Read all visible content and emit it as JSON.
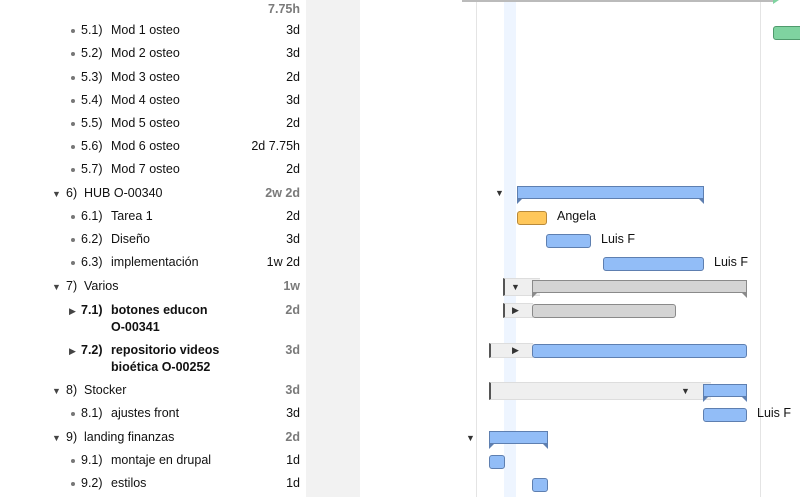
{
  "outline": {
    "top_partial_duration": "7.75h",
    "rows": [
      {
        "num": "5.1)",
        "name": "Mod 1 osteo",
        "duration": "3d",
        "kind": "leaf"
      },
      {
        "num": "5.2)",
        "name": "Mod 2 osteo",
        "duration": "3d",
        "kind": "leaf"
      },
      {
        "num": "5.3)",
        "name": "Mod 3 osteo",
        "duration": "2d",
        "kind": "leaf"
      },
      {
        "num": "5.4)",
        "name": "Mod 4 osteo",
        "duration": "3d",
        "kind": "leaf"
      },
      {
        "num": "5.5)",
        "name": "Mod 5 osteo",
        "duration": "2d",
        "kind": "leaf"
      },
      {
        "num": "5.6)",
        "name": "Mod 6 osteo",
        "duration": "2d 7.75h",
        "kind": "leaf"
      },
      {
        "num": "5.7)",
        "name": "Mod 7 osteo",
        "duration": "2d",
        "kind": "leaf"
      },
      {
        "num": "6)",
        "name": "HUB O-00340",
        "duration": "2w 2d",
        "kind": "group"
      },
      {
        "num": "6.1)",
        "name": "Tarea 1",
        "duration": "2d",
        "kind": "leaf"
      },
      {
        "num": "6.2)",
        "name": "Diseño",
        "duration": "3d",
        "kind": "leaf"
      },
      {
        "num": "6.3)",
        "name": "implementación",
        "duration": "1w 2d",
        "kind": "leaf"
      },
      {
        "num": "7)",
        "name": "Varios",
        "duration": "1w",
        "kind": "group"
      },
      {
        "num": "7.1)",
        "name": "botones educon O-00341",
        "duration": "2d",
        "kind": "subgroup"
      },
      {
        "num": "7.2)",
        "name": "repositorio videos bioética O-00252",
        "duration": "3d",
        "kind": "subgroup"
      },
      {
        "num": "8)",
        "name": "Stocker",
        "duration": "3d",
        "kind": "group"
      },
      {
        "num": "8.1)",
        "name": "ajustes front",
        "duration": "3d",
        "kind": "leaf"
      },
      {
        "num": "9)",
        "name": "landing finanzas",
        "duration": "2d",
        "kind": "group"
      },
      {
        "num": "9.1)",
        "name": "montaje en drupal",
        "duration": "1d",
        "kind": "leaf"
      },
      {
        "num": "9.2)",
        "name": "estilos",
        "duration": "1d",
        "kind": "leaf"
      }
    ]
  },
  "gantt": {
    "resources": {
      "t61": "Angela",
      "t62": "Luis F",
      "t63": "Luis F",
      "t81": "Luis F"
    },
    "colors": {
      "task": "#92bdf7",
      "orange": "#ffc75a",
      "green": "#7fd3a0",
      "inactive": "#d4d4d4",
      "today": "#eef5ff"
    }
  }
}
